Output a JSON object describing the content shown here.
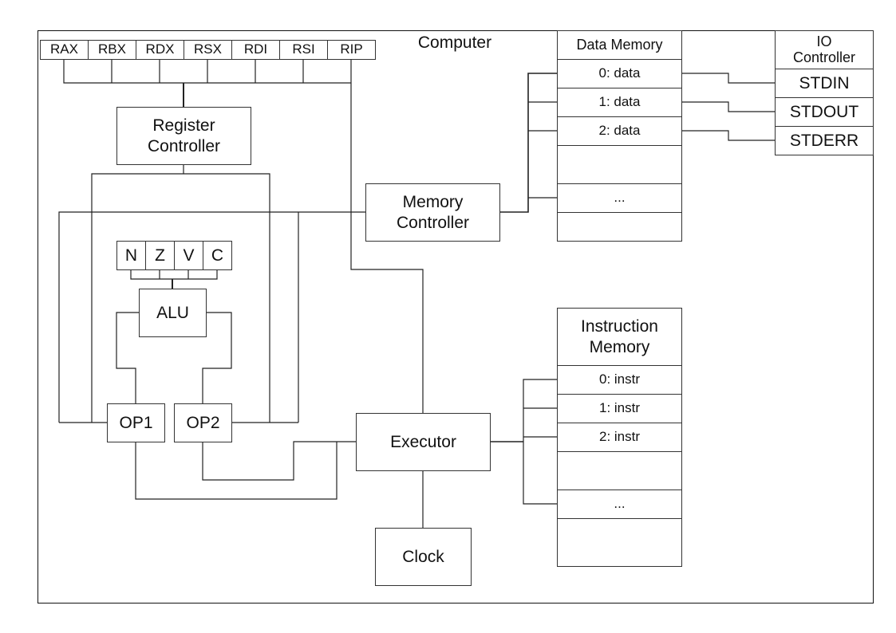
{
  "computer": {
    "title": "Computer"
  },
  "registers": [
    "RAX",
    "RBX",
    "RDX",
    "RSX",
    "RDI",
    "RSI",
    "RIP"
  ],
  "register_controller": {
    "line1": "Register",
    "line2": "Controller"
  },
  "flags": [
    "N",
    "Z",
    "V",
    "C"
  ],
  "alu": {
    "label": "ALU"
  },
  "operands": {
    "op1": "OP1",
    "op2": "OP2"
  },
  "memory_controller": {
    "line1": "Memory",
    "line2": "Controller"
  },
  "data_memory": {
    "title": "Data Memory",
    "rows": [
      "0: data",
      "1: data",
      "2: data",
      "",
      "...",
      ""
    ]
  },
  "io_controller": {
    "line1": "IO",
    "line2": "Controller",
    "streams": [
      "STDIN",
      "STDOUT",
      "STDERR"
    ]
  },
  "executor": {
    "label": "Executor"
  },
  "clock": {
    "label": "Clock"
  },
  "instruction_memory": {
    "line1": "Instruction",
    "line2": "Memory",
    "rows": [
      "0: instr",
      "1: instr",
      "2: instr",
      "",
      "...",
      ""
    ]
  }
}
